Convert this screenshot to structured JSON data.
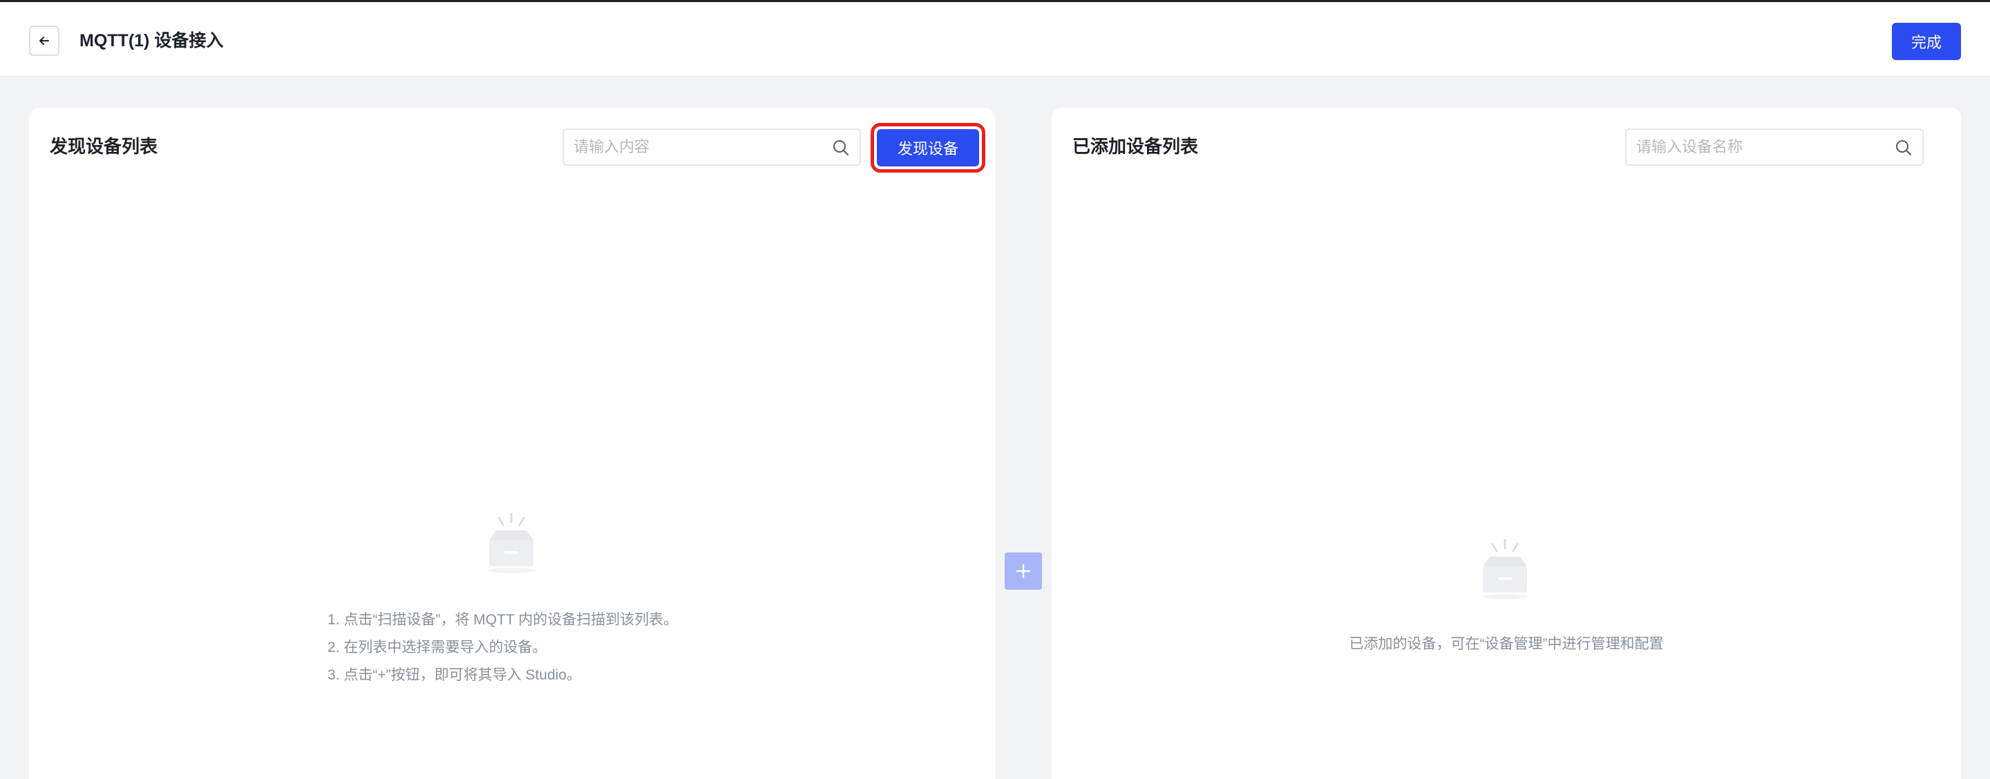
{
  "header": {
    "title": "MQTT(1) 设备接入",
    "done_label": "完成"
  },
  "discover_panel": {
    "title": "发现设备列表",
    "search_placeholder": "请输入内容",
    "discover_button_label": "发现设备",
    "hints": [
      "1. 点击“扫描设备”，将 MQTT 内的设备扫描到该列表。",
      "2. 在列表中选择需要导入的设备。",
      "3. 点击“+”按钮，即可将其导入 Studio。"
    ]
  },
  "added_panel": {
    "title": "已添加设备列表",
    "search_placeholder": "请输入设备名称",
    "empty_text": "已添加的设备，可在“设备管理”中进行管理和配置"
  },
  "icons": {
    "back": "arrow-left-icon",
    "search": "search-icon",
    "add": "plus-icon",
    "empty": "empty-box-icon"
  },
  "colors": {
    "primary": "#2b4cf0",
    "highlight_border": "#e8221b",
    "add_button_disabled": "#a7b6f8"
  }
}
